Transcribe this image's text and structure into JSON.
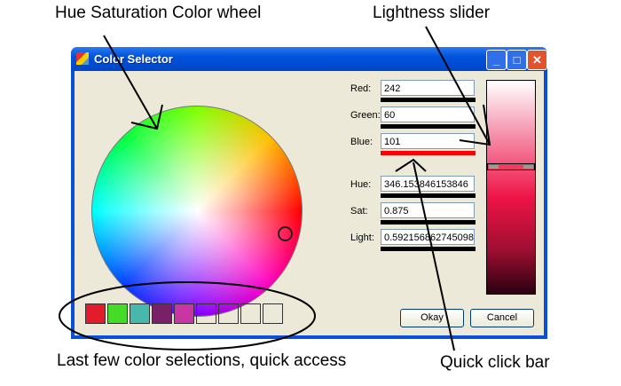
{
  "annotations": {
    "wheel": "Hue Saturation Color wheel",
    "slider": "Lightness slider",
    "recent": "Last few color selections, quick access",
    "quickbar": "Quick click bar"
  },
  "window": {
    "title": "Color Selector",
    "minimize": "_",
    "maximize": "□",
    "close": "✕"
  },
  "fields": [
    {
      "label": "Red:",
      "value": "242"
    },
    {
      "label": "Green:",
      "value": "60"
    },
    {
      "label": "Blue:",
      "value": "101"
    },
    {
      "label": "Hue:",
      "value": "346.153846153846"
    },
    {
      "label": "Sat:",
      "value": "0.875"
    },
    {
      "label": "Light:",
      "value": "0.592156862745098"
    }
  ],
  "selected_color": "#f23c65",
  "lightness": 0.592,
  "recent_colors": [
    "#e31c2c",
    "#45dc28",
    "#48b8ac",
    "#782068",
    "#c836a4",
    "",
    "",
    "",
    ""
  ],
  "buttons": {
    "okay": "Okay",
    "cancel": "Cancel"
  }
}
